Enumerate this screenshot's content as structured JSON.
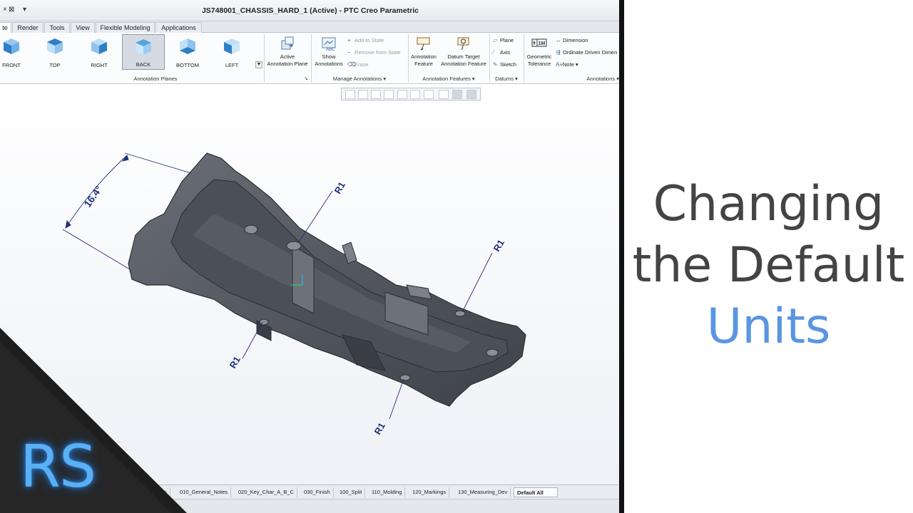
{
  "window": {
    "title": "JS748001_CHASSIS_HARD_1 (Active) - PTC Creo Parametric",
    "quick_access": [
      "×",
      "⊠",
      "▾"
    ]
  },
  "tabs": [
    {
      "label": "te",
      "active": true
    },
    {
      "label": "Render"
    },
    {
      "label": "Tools"
    },
    {
      "label": "View"
    },
    {
      "label": "Flexible Modeling"
    },
    {
      "label": "Applications"
    }
  ],
  "ribbon": {
    "views": [
      {
        "label": "FRONT"
      },
      {
        "label": "TOP"
      },
      {
        "label": "RIGHT"
      },
      {
        "label": "BACK",
        "selected": true
      },
      {
        "label": "BOTTOM"
      },
      {
        "label": "LEFT"
      }
    ],
    "scroll_glyph": "▼",
    "groups": {
      "annotation_planes": "Annotation Planes",
      "manage_annotations": "Manage Annotations ▾",
      "annotation_features": "Annotation Features ▾",
      "datums": "Datums ▾",
      "annotations": "Annotations ▾"
    },
    "group_launcher": "↘",
    "commands": {
      "active_annotation_plane": [
        "Active",
        "Annotation Plane"
      ],
      "show_annotations": [
        "Show",
        "Annotations"
      ],
      "add_to_state": "Add to State",
      "remove_from_state": "Remove from State",
      "erase": "Erase",
      "annotation_feature": [
        "Annotation",
        "Feature"
      ],
      "datum_target": [
        "Datum Target",
        "Annotation Feature"
      ],
      "plane": "Plane",
      "axis": "Axis",
      "sketch": "Sketch",
      "geometric_tolerance": [
        "Geometric",
        "Tolerance"
      ],
      "dimension": "Dimension",
      "ordinate_driven": "Ordinate Driven Dimen",
      "note": "Note ▾"
    }
  },
  "annotations": {
    "angle": "16.4°",
    "radius_labels": [
      "R1",
      "R1",
      "R1",
      "R1"
    ]
  },
  "bottom_tabs": [
    {
      "label": "s"
    },
    {
      "label": "010_General_Notes"
    },
    {
      "label": "020_Key_Char_A_B_C"
    },
    {
      "label": "030_Finish"
    },
    {
      "label": "100_Split"
    },
    {
      "label": "110_Molding"
    },
    {
      "label": "120_Markings"
    },
    {
      "label": "130_Measuring_Dev"
    },
    {
      "label": "Default All",
      "active": true
    }
  ],
  "hero": {
    "line1": "Changing",
    "line2": "the Default",
    "line3": "Units",
    "accent_color": "#5b95e2"
  },
  "logo": {
    "text": "RS",
    "color": "#5ab0f5"
  }
}
